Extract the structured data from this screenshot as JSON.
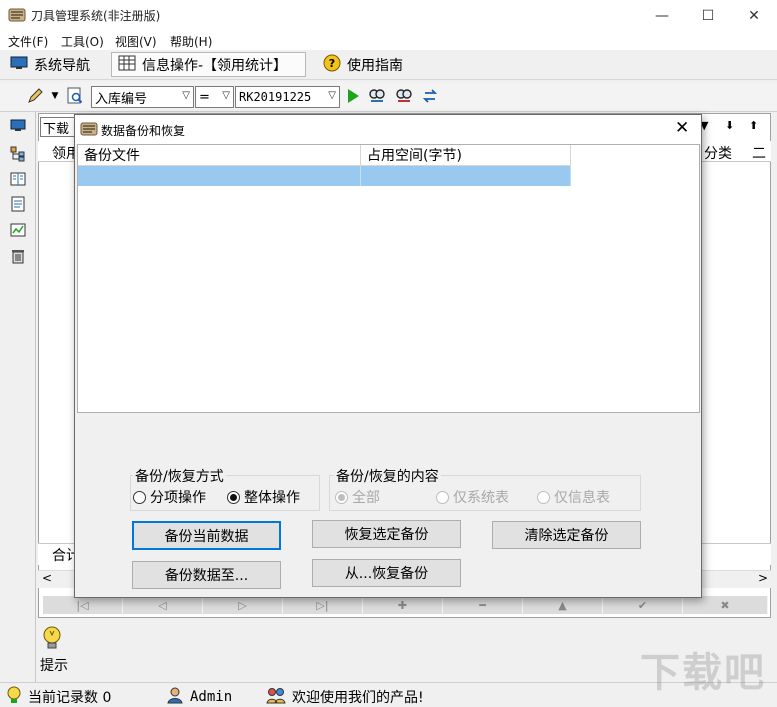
{
  "window": {
    "title": "刀具管理系统(非注册版)",
    "controls": [
      "—",
      "☐",
      "✕"
    ]
  },
  "menu": [
    "文件(F)",
    "工具(O)",
    "视图(V)",
    "帮助(H)"
  ],
  "nav": {
    "system_nav": "系统导航",
    "info_op": "信息操作-【领用统计】",
    "guide": "使用指南"
  },
  "filter": {
    "field": "入库编号",
    "operator": "=",
    "value": "RK20191225"
  },
  "background": {
    "tab_partial": "下载",
    "col_partial": "领用",
    "col_right": "分类",
    "col_right2": "二",
    "total_label": "合计",
    "hint_label": "提示",
    "nav_buttons": [
      "|◁",
      "◁",
      "▷",
      "▷|",
      "✚",
      "━",
      "▲",
      "✔",
      "✖"
    ]
  },
  "status": {
    "record_count": "当前记录数 0",
    "user": "Admin",
    "welcome": "欢迎使用我们的产品!"
  },
  "dialog": {
    "title": "数据备份和恢复",
    "columns": [
      "备份文件",
      "占用空间(字节)"
    ],
    "mode_group": "备份/恢复方式",
    "mode_options": [
      {
        "label": "分项操作",
        "selected": false
      },
      {
        "label": "整体操作",
        "selected": true
      }
    ],
    "content_group": "备份/恢复的内容",
    "content_options": [
      {
        "label": "全部",
        "selected": true
      },
      {
        "label": "仅系统表",
        "selected": false
      },
      {
        "label": "仅信息表",
        "selected": false
      }
    ],
    "buttons": {
      "backup_current": "备份当前数据",
      "restore_selected": "恢复选定备份",
      "clear_selected": "清除选定备份",
      "backup_to": "备份数据至...",
      "restore_from": "从...恢复备份"
    }
  },
  "watermark": "下载吧"
}
